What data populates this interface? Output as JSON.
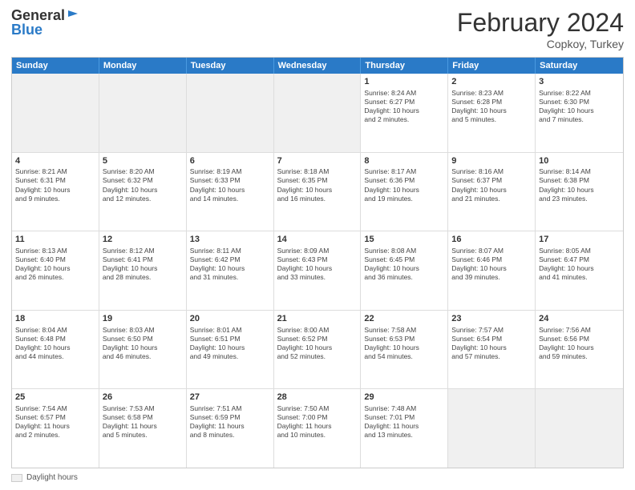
{
  "header": {
    "logo_line1": "General",
    "logo_line2": "Blue",
    "title": "February 2024",
    "location": "Copkoy, Turkey"
  },
  "days": [
    "Sunday",
    "Monday",
    "Tuesday",
    "Wednesday",
    "Thursday",
    "Friday",
    "Saturday"
  ],
  "legend": {
    "label": "Daylight hours"
  },
  "rows": [
    [
      {
        "day": "",
        "text": ""
      },
      {
        "day": "",
        "text": ""
      },
      {
        "day": "",
        "text": ""
      },
      {
        "day": "",
        "text": ""
      },
      {
        "day": "1",
        "text": "Sunrise: 8:24 AM\nSunset: 6:27 PM\nDaylight: 10 hours\nand 2 minutes."
      },
      {
        "day": "2",
        "text": "Sunrise: 8:23 AM\nSunset: 6:28 PM\nDaylight: 10 hours\nand 5 minutes."
      },
      {
        "day": "3",
        "text": "Sunrise: 8:22 AM\nSunset: 6:30 PM\nDaylight: 10 hours\nand 7 minutes."
      }
    ],
    [
      {
        "day": "4",
        "text": "Sunrise: 8:21 AM\nSunset: 6:31 PM\nDaylight: 10 hours\nand 9 minutes."
      },
      {
        "day": "5",
        "text": "Sunrise: 8:20 AM\nSunset: 6:32 PM\nDaylight: 10 hours\nand 12 minutes."
      },
      {
        "day": "6",
        "text": "Sunrise: 8:19 AM\nSunset: 6:33 PM\nDaylight: 10 hours\nand 14 minutes."
      },
      {
        "day": "7",
        "text": "Sunrise: 8:18 AM\nSunset: 6:35 PM\nDaylight: 10 hours\nand 16 minutes."
      },
      {
        "day": "8",
        "text": "Sunrise: 8:17 AM\nSunset: 6:36 PM\nDaylight: 10 hours\nand 19 minutes."
      },
      {
        "day": "9",
        "text": "Sunrise: 8:16 AM\nSunset: 6:37 PM\nDaylight: 10 hours\nand 21 minutes."
      },
      {
        "day": "10",
        "text": "Sunrise: 8:14 AM\nSunset: 6:38 PM\nDaylight: 10 hours\nand 23 minutes."
      }
    ],
    [
      {
        "day": "11",
        "text": "Sunrise: 8:13 AM\nSunset: 6:40 PM\nDaylight: 10 hours\nand 26 minutes."
      },
      {
        "day": "12",
        "text": "Sunrise: 8:12 AM\nSunset: 6:41 PM\nDaylight: 10 hours\nand 28 minutes."
      },
      {
        "day": "13",
        "text": "Sunrise: 8:11 AM\nSunset: 6:42 PM\nDaylight: 10 hours\nand 31 minutes."
      },
      {
        "day": "14",
        "text": "Sunrise: 8:09 AM\nSunset: 6:43 PM\nDaylight: 10 hours\nand 33 minutes."
      },
      {
        "day": "15",
        "text": "Sunrise: 8:08 AM\nSunset: 6:45 PM\nDaylight: 10 hours\nand 36 minutes."
      },
      {
        "day": "16",
        "text": "Sunrise: 8:07 AM\nSunset: 6:46 PM\nDaylight: 10 hours\nand 39 minutes."
      },
      {
        "day": "17",
        "text": "Sunrise: 8:05 AM\nSunset: 6:47 PM\nDaylight: 10 hours\nand 41 minutes."
      }
    ],
    [
      {
        "day": "18",
        "text": "Sunrise: 8:04 AM\nSunset: 6:48 PM\nDaylight: 10 hours\nand 44 minutes."
      },
      {
        "day": "19",
        "text": "Sunrise: 8:03 AM\nSunset: 6:50 PM\nDaylight: 10 hours\nand 46 minutes."
      },
      {
        "day": "20",
        "text": "Sunrise: 8:01 AM\nSunset: 6:51 PM\nDaylight: 10 hours\nand 49 minutes."
      },
      {
        "day": "21",
        "text": "Sunrise: 8:00 AM\nSunset: 6:52 PM\nDaylight: 10 hours\nand 52 minutes."
      },
      {
        "day": "22",
        "text": "Sunrise: 7:58 AM\nSunset: 6:53 PM\nDaylight: 10 hours\nand 54 minutes."
      },
      {
        "day": "23",
        "text": "Sunrise: 7:57 AM\nSunset: 6:54 PM\nDaylight: 10 hours\nand 57 minutes."
      },
      {
        "day": "24",
        "text": "Sunrise: 7:56 AM\nSunset: 6:56 PM\nDaylight: 10 hours\nand 59 minutes."
      }
    ],
    [
      {
        "day": "25",
        "text": "Sunrise: 7:54 AM\nSunset: 6:57 PM\nDaylight: 11 hours\nand 2 minutes."
      },
      {
        "day": "26",
        "text": "Sunrise: 7:53 AM\nSunset: 6:58 PM\nDaylight: 11 hours\nand 5 minutes."
      },
      {
        "day": "27",
        "text": "Sunrise: 7:51 AM\nSunset: 6:59 PM\nDaylight: 11 hours\nand 8 minutes."
      },
      {
        "day": "28",
        "text": "Sunrise: 7:50 AM\nSunset: 7:00 PM\nDaylight: 11 hours\nand 10 minutes."
      },
      {
        "day": "29",
        "text": "Sunrise: 7:48 AM\nSunset: 7:01 PM\nDaylight: 11 hours\nand 13 minutes."
      },
      {
        "day": "",
        "text": ""
      },
      {
        "day": "",
        "text": ""
      }
    ]
  ]
}
